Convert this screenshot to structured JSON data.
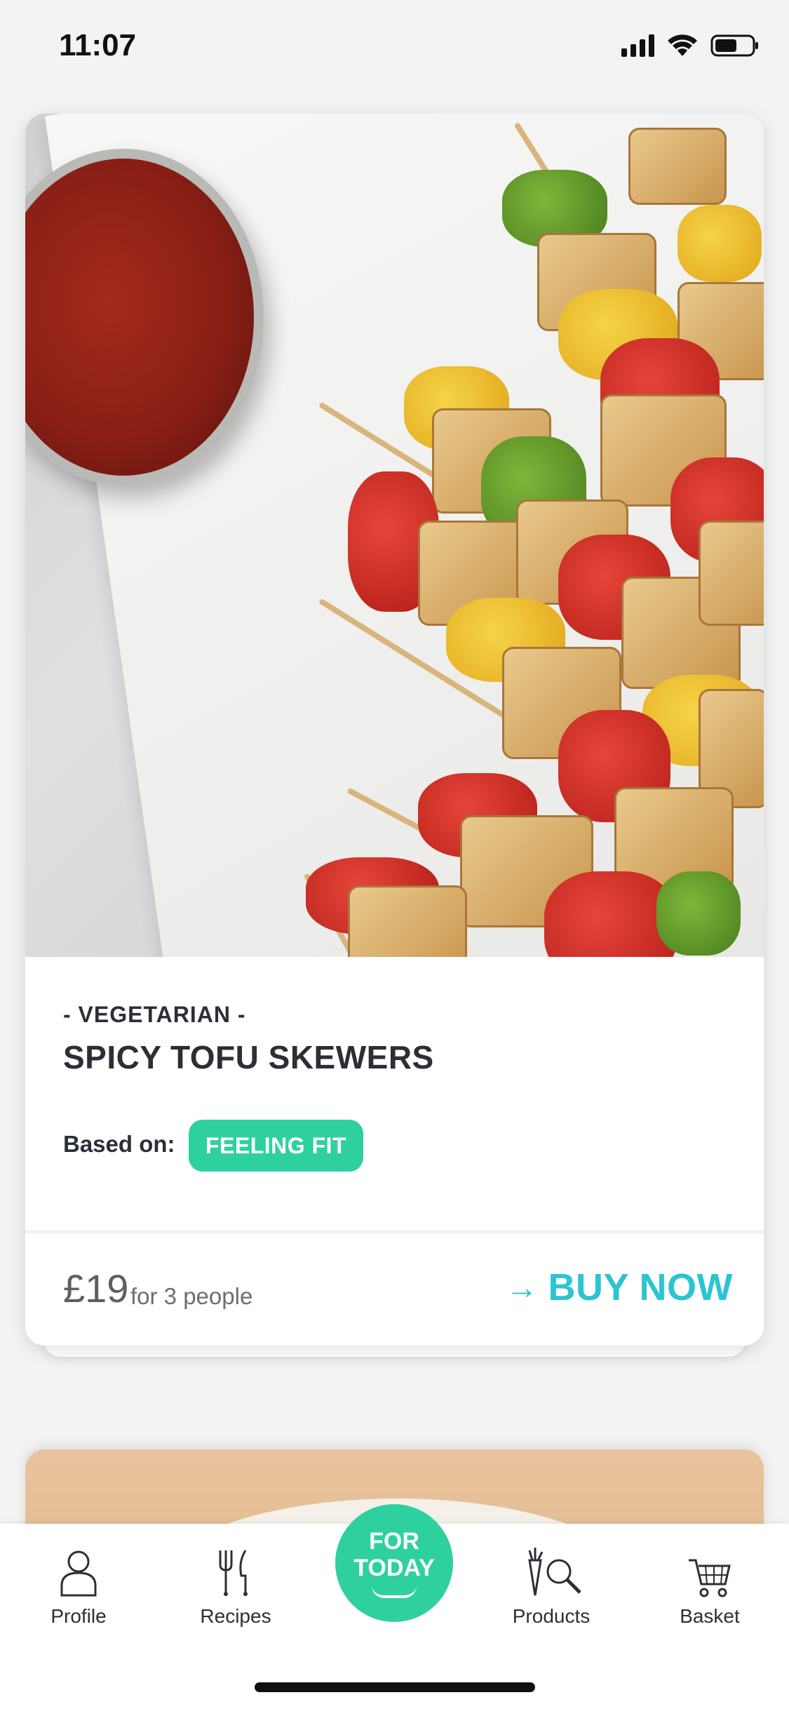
{
  "status_bar": {
    "time": "11:07"
  },
  "recipe_card": {
    "category": "- VEGETARIAN -",
    "title": "SPICY TOFU SKEWERS",
    "based_on_label": "Based on:",
    "tag": "FEELING FIT",
    "price": "£19",
    "people": "for 3 people",
    "cta_label": "BUY NOW",
    "cta_arrow": "→",
    "accent_color": "#2cc4d2",
    "tag_color": "#2fd0a0"
  },
  "tab_bar": {
    "items": [
      {
        "label": "Profile",
        "icon": "person-icon"
      },
      {
        "label": "Recipes",
        "icon": "fork-knife-icon"
      },
      {
        "label": "FOR TODAY",
        "line1": "FOR",
        "line2": "TODAY",
        "icon": "for-today-badge"
      },
      {
        "label": "Products",
        "icon": "carrot-search-icon"
      },
      {
        "label": "Basket",
        "icon": "cart-icon"
      }
    ]
  }
}
